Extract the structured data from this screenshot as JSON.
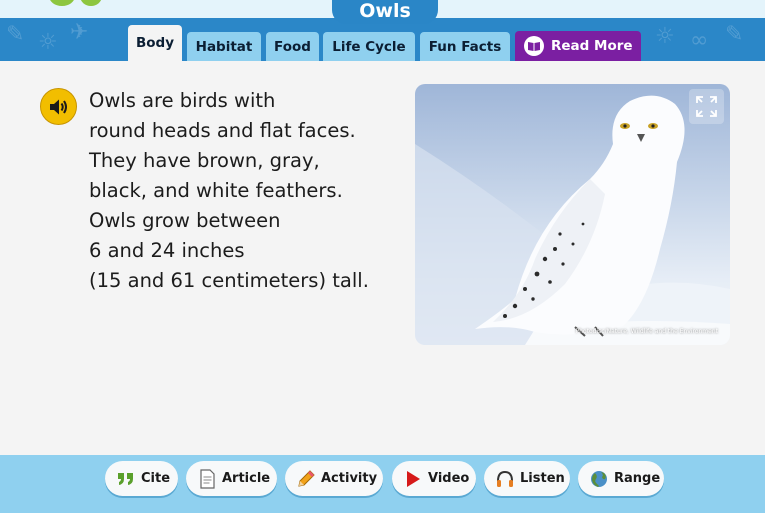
{
  "header": {
    "title": "Owls"
  },
  "tabs": [
    {
      "label": "Body",
      "active": true
    },
    {
      "label": "Habitat",
      "active": false
    },
    {
      "label": "Food",
      "active": false
    },
    {
      "label": "Life Cycle",
      "active": false
    },
    {
      "label": "Fun Facts",
      "active": false
    }
  ],
  "read_more": {
    "label": "Read More",
    "icon": "book-icon"
  },
  "article": {
    "lines": [
      "Owls are birds with",
      "round heads and flat faces.",
      "They have brown, gray,",
      "black, and white feathers.",
      "Owls grow between",
      "6 and 24 inches",
      "(15 and 61 centimeters) tall."
    ]
  },
  "image": {
    "credit": "Photodisc/Nature, Wildlife and the Environment"
  },
  "toolbar": [
    {
      "label": "Cite",
      "icon": "quote-icon"
    },
    {
      "label": "Article",
      "icon": "document-icon"
    },
    {
      "label": "Activity",
      "icon": "pencil-icon"
    },
    {
      "label": "Video",
      "icon": "play-icon"
    },
    {
      "label": "Listen",
      "icon": "headphones-icon"
    },
    {
      "label": "Range",
      "icon": "globe-icon"
    }
  ],
  "colors": {
    "tab_bar": "#2b87c8",
    "tab": "#8fd0ef",
    "read_more": "#7b1fa2",
    "audio_button": "#f2be00",
    "bottom_bar": "#8fd0ef"
  }
}
